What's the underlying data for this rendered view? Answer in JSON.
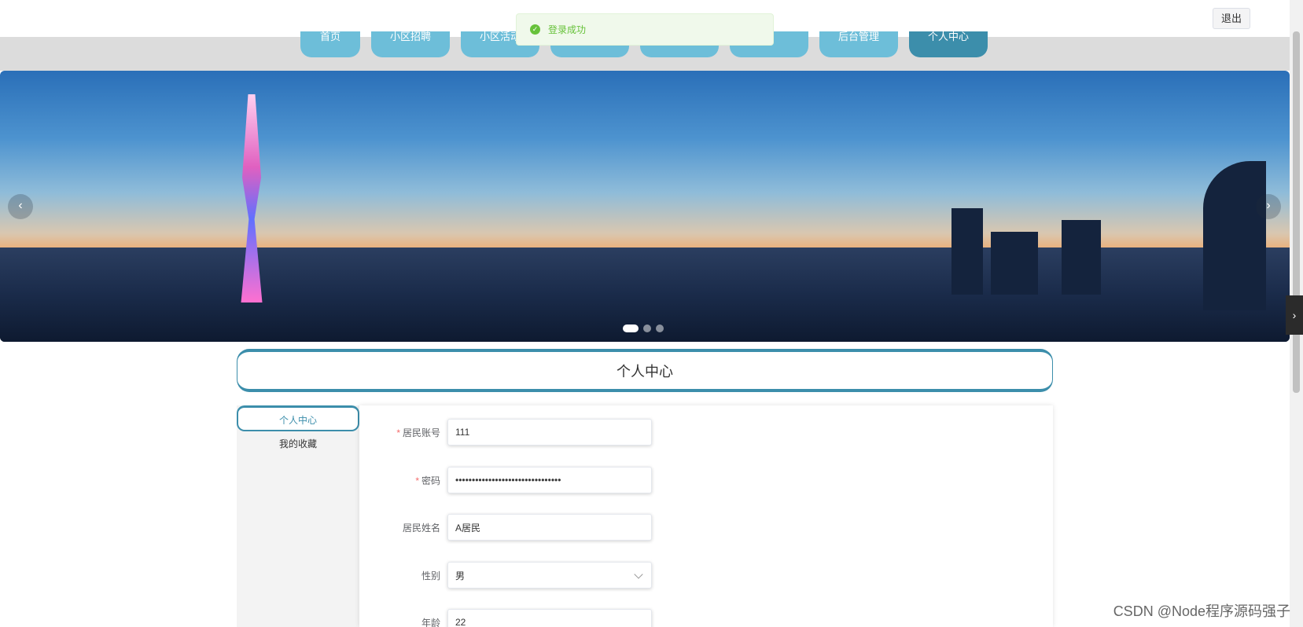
{
  "header": {
    "logout_label": "退出"
  },
  "nav": {
    "items": [
      {
        "label": "首页"
      },
      {
        "label": "小区招聘"
      },
      {
        "label": "小区活动"
      },
      {
        "label": ""
      },
      {
        "label": ""
      },
      {
        "label": ""
      },
      {
        "label": "后台管理"
      },
      {
        "label": "个人中心"
      }
    ]
  },
  "toast": {
    "message": "登录成功"
  },
  "banner": {
    "active_slide": 1,
    "slide_count": 3
  },
  "page": {
    "title": "个人中心"
  },
  "sidemenu": {
    "items": [
      {
        "label": "个人中心"
      },
      {
        "label": "我的收藏"
      }
    ]
  },
  "form": {
    "account": {
      "label": "居民账号",
      "value": "111"
    },
    "password": {
      "label": "密码",
      "value": "••••••••••••••••••••••••••••••••"
    },
    "name": {
      "label": "居民姓名",
      "value": "A居民"
    },
    "gender": {
      "label": "性别",
      "value": "男"
    },
    "age": {
      "label": "年龄",
      "value": "22"
    }
  },
  "watermark": "CSDN @Node程序源码强子"
}
